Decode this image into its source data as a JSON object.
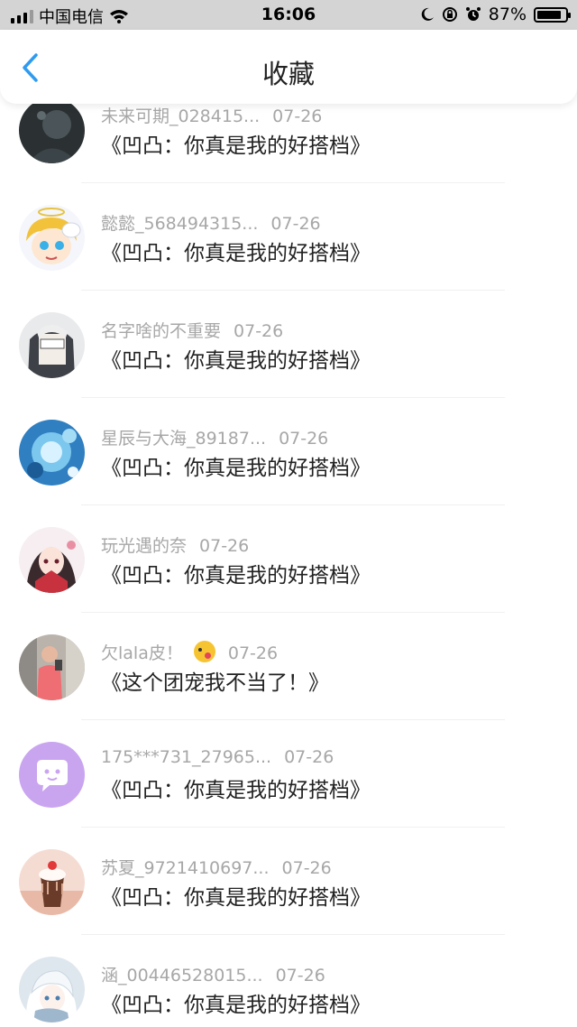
{
  "status_bar": {
    "carrier": "中国电信",
    "time": "16:06",
    "battery_percent": "87%",
    "battery_level": 0.87
  },
  "nav": {
    "title": "收藏",
    "back_icon": "chevron-left-icon"
  },
  "colors": {
    "accent": "#2f9bf0",
    "status_bar_bg": "#d4d4d4",
    "meta_text": "#a7a7a7"
  },
  "items": [
    {
      "user": "未来可期_028415...",
      "date": "07-26",
      "title": "《凹凸：你真是我的好搭档》",
      "avatar": "dark-avatar"
    },
    {
      "user": "懿懿_568494315...",
      "date": "07-26",
      "title": "《凹凸：你真是我的好搭档》",
      "avatar": "anime-yellow-avatar"
    },
    {
      "user": "名字啥的不重要",
      "date": "07-26",
      "title": "《凹凸：你真是我的好搭档》",
      "avatar": "anime-grey-avatar"
    },
    {
      "user": "星辰与大海_89187...",
      "date": "07-26",
      "title": "《凹凸：你真是我的好搭档》",
      "avatar": "blue-art-avatar"
    },
    {
      "user": "玩光遇的奈",
      "date": "07-26",
      "title": "《凹凸：你真是我的好搭档》",
      "avatar": "anime-red-avatar"
    },
    {
      "user": "欠lala皮！",
      "date": "07-26",
      "title": "《这个团宠我不当了！》",
      "avatar": "photo-avatar",
      "emoji": "tongue-wink-emoji"
    },
    {
      "user": "175***731_27965...",
      "date": "07-26",
      "title": "《凹凸：你真是我的好搭档》",
      "avatar": "default-purple-avatar"
    },
    {
      "user": "苏夏_9721410697...",
      "date": "07-26",
      "title": "《凹凸：你真是我的好搭档》",
      "avatar": "dessert-avatar"
    },
    {
      "user": "涵_00446528015...",
      "date": "07-26",
      "title": "《凹凸：你真是我的好搭档》",
      "avatar": "anime-white-avatar"
    }
  ]
}
